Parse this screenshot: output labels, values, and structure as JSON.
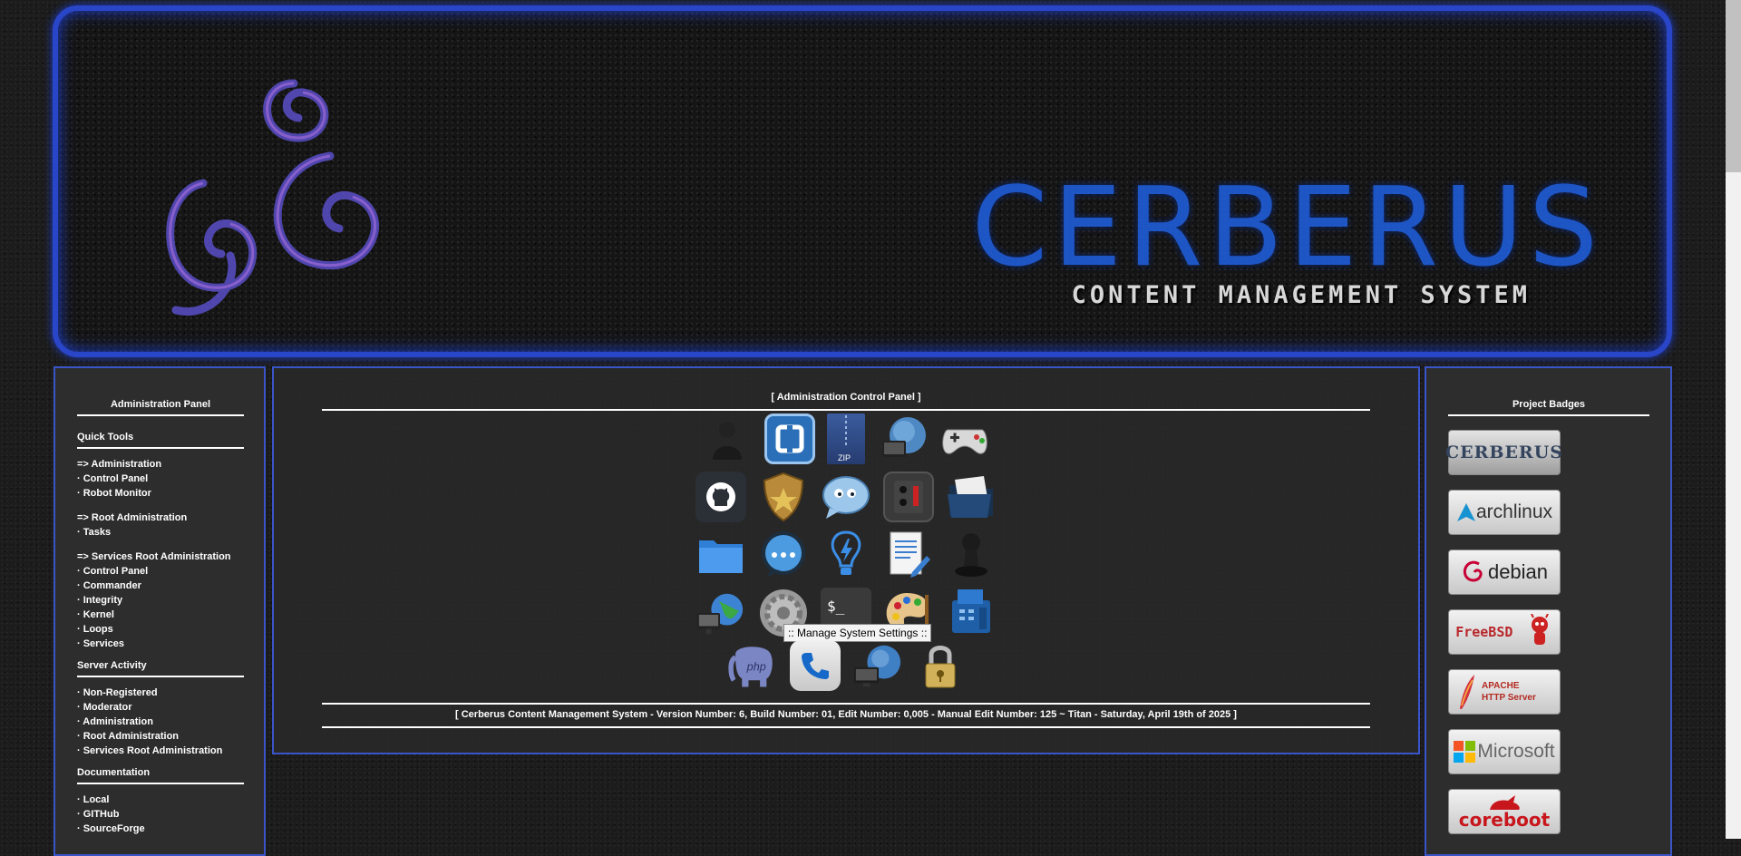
{
  "banner": {
    "title": "CERBERUS",
    "subtitle": "CONTENT MANAGEMENT SYSTEM"
  },
  "left_panel": {
    "title": "Administration Panel",
    "quick_tools": {
      "heading": "Quick Tools",
      "admin_header": "=> Administration",
      "admin_links": [
        "· Control Panel",
        "· Robot Monitor"
      ],
      "root_header": "=> Root Administration",
      "root_links": [
        "· Tasks"
      ],
      "services_header": "=> Services Root Administration",
      "services_links": [
        "· Control Panel",
        "· Commander",
        "· Integrity",
        "· Kernel",
        "· Loops",
        "· Services"
      ]
    },
    "server_activity": {
      "heading": "Server Activity",
      "links": [
        "· Non-Registered",
        "· Moderator",
        "· Administration",
        "· Root Administration",
        "· Services Root Administration"
      ]
    },
    "documentation": {
      "heading": "Documentation",
      "links": [
        "· Local",
        "· GITHub",
        "· SourceForge"
      ]
    }
  },
  "center_panel": {
    "title": "[ Administration Control Panel ]",
    "tooltip": ":: Manage System Settings ::",
    "footer": "[ Cerberus Content Management System - Version Number: 6, Build Number: 01, Edit Number: 0,005 - Manual Edit Number: 125 ~ Titan - Saturday, April 19th of 2025 ]",
    "icon_rows": [
      [
        "user-silhouette-icon",
        "bracket-app-icon",
        "zip-archive-icon",
        "network-monitor-icon",
        "gamepad-icon"
      ],
      [
        "github-icon",
        "security-badge-icon",
        "chat-bubble-icon",
        "power-strip-icon",
        "open-folder-icon"
      ],
      [
        "folder-icon",
        "message-icon",
        "lightbulb-icon",
        "document-edit-icon",
        "chess-pawn-icon"
      ],
      [
        "globe-network-icon",
        "settings-gear-icon",
        "terminal-icon",
        "paint-palette-icon",
        "fax-icon"
      ],
      [
        "php-elephant-icon",
        "phone-icon",
        "network-globe-icon",
        "lock-icon"
      ]
    ]
  },
  "right_panel": {
    "title": "Project Badges",
    "badges": [
      "CERBERUS",
      "archlinux",
      "debian",
      "FreeBSD",
      "APACHE HTTP Server",
      "Microsoft",
      "coreboot"
    ]
  }
}
